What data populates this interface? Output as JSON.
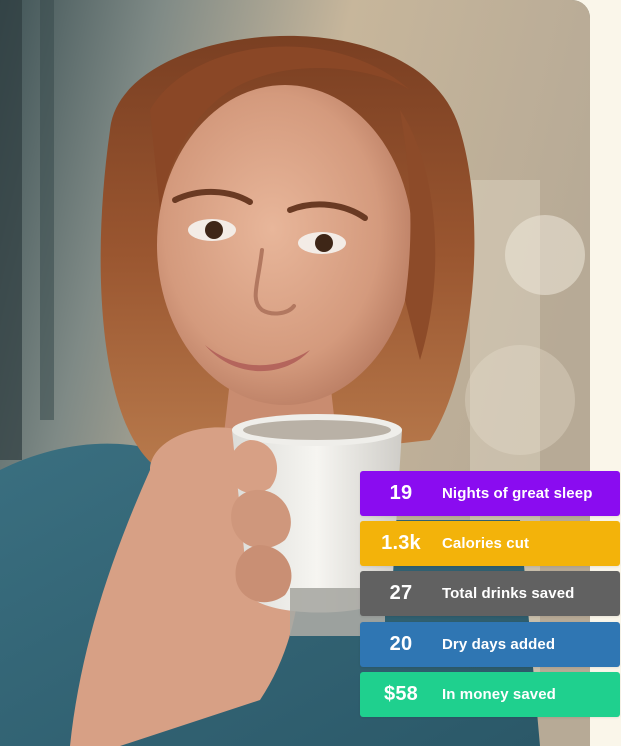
{
  "background_color": "#faf6ea",
  "hero_image": {
    "subject": "woman holding white coffee mug"
  },
  "stats": [
    {
      "value": "19",
      "label": "Nights of great sleep",
      "color": "#8a0cf0"
    },
    {
      "value": "1.3k",
      "label": "Calories cut",
      "color": "#f3b30a"
    },
    {
      "value": "27",
      "label": "Total drinks saved",
      "color": "#616161"
    },
    {
      "value": "20",
      "label": "Dry days added",
      "color": "#2f76b3"
    },
    {
      "value": "$58",
      "label": "In money saved",
      "color": "#1fd08e"
    }
  ]
}
